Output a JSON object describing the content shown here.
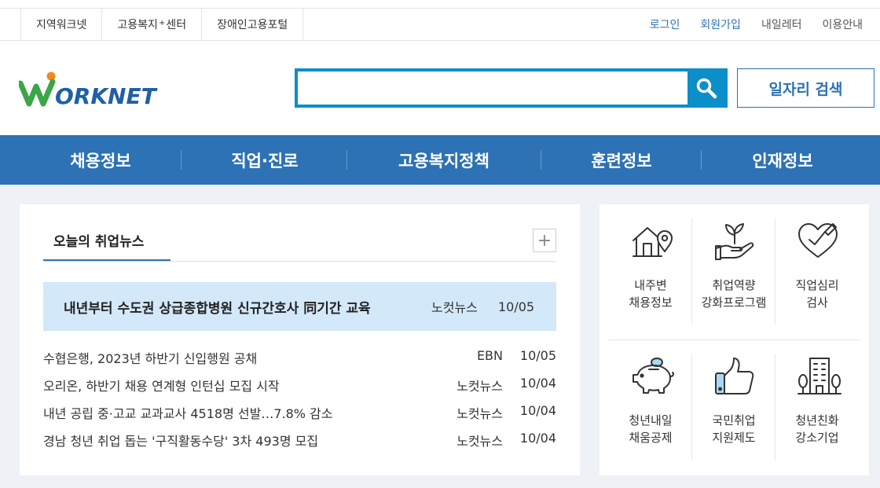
{
  "colors": {
    "brand_blue": "#2d72b4",
    "search_blue": "#0c8ec9",
    "featured_bg": "#d3e8f9",
    "logo_green": "#3aa647",
    "logo_orange": "#f08a1c",
    "logo_blue": "#1f5fa6"
  },
  "topbar": {
    "left_links": [
      {
        "label": "지역워크넷"
      },
      {
        "label_pre": "고용복지",
        "label_sup": "+",
        "label_post": "센터"
      },
      {
        "label": "장애인고용포털"
      }
    ],
    "right_links": [
      "로그인",
      "회원가입",
      "내일레터",
      "이용안내"
    ]
  },
  "header": {
    "logo_text": "WORKNET",
    "search_value": "",
    "search_icon": "search-icon",
    "job_search_label": "일자리 검색"
  },
  "gnb": {
    "items": [
      "채용정보",
      "직업·진로",
      "고용복지정책",
      "훈련정보",
      "인재정보"
    ]
  },
  "news": {
    "tab_label": "오늘의 취업뉴스",
    "more_label": "+",
    "featured": {
      "title": "내년부터 수도권 상급종합병원 신규간호사 同기간 교육",
      "source": "노컷뉴스",
      "date": "10/05"
    },
    "items": [
      {
        "title": "수협은행, 2023년 하반기 신입행원 공채",
        "source": "EBN",
        "date": "10/05"
      },
      {
        "title": "오리온, 하반기 채용 연계형 인턴십 모집 시작",
        "source": "노컷뉴스",
        "date": "10/04"
      },
      {
        "title": "내년 공립 중·고교 교과교사 4518명 선발…7.8% 감소",
        "source": "노컷뉴스",
        "date": "10/04"
      },
      {
        "title": "경남 청년 취업 돕는 '구직활동수당' 3차 493명 모집",
        "source": "노컷뉴스",
        "date": "10/04"
      }
    ]
  },
  "quick_menu": {
    "items": [
      {
        "label": "내주변\n채용정보",
        "icon": "house-location-icon"
      },
      {
        "label": "취업역량\n강화프로그램",
        "icon": "sprout-hand-icon"
      },
      {
        "label": "직업심리\n검사",
        "icon": "heart-check-icon"
      },
      {
        "label": "청년내일\n채움공제",
        "icon": "piggy-bank-icon"
      },
      {
        "label": "국민취업\n지원제도",
        "icon": "thumbs-up-icon"
      },
      {
        "label": "청년친화\n강소기업",
        "icon": "building-icon"
      }
    ]
  }
}
